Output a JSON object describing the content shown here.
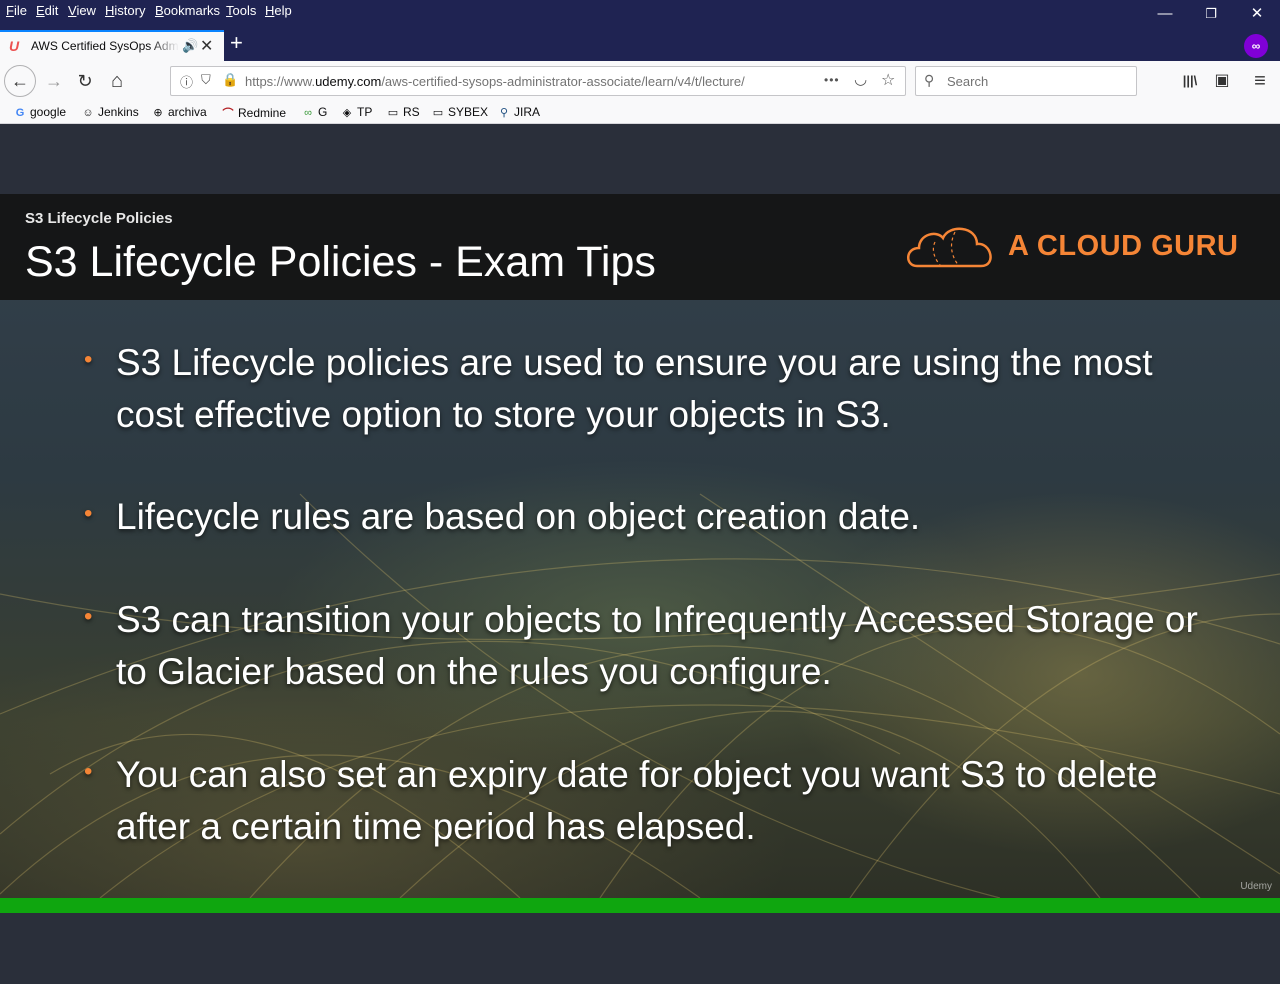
{
  "menubar": {
    "items": [
      "File",
      "Edit",
      "View",
      "History",
      "Bookmarks",
      "Tools",
      "Help"
    ],
    "window_controls": [
      "—",
      "❐",
      "✕"
    ]
  },
  "tab": {
    "title": "AWS Certified SysOps Administrator - Associate",
    "favicon": "U",
    "audio_icon": "🔊",
    "close": "✕",
    "new_tab": "+"
  },
  "private_badge": "∞",
  "navbar": {
    "back": "←",
    "forward": "→",
    "reload": "↻",
    "home": "⌂",
    "url_prefix": "https://www.",
    "url_domain": "udemy.com",
    "url_rest": "/aws-certified-sysops-administrator-associate/learn/v4/t/lecture/",
    "page_actions": "•••",
    "pocket": "◡",
    "bookmark_star": "☆",
    "search_placeholder": "Search",
    "library": "|||\\",
    "sidebar": "▣",
    "menu": "≡"
  },
  "bookmarks": [
    {
      "label": "google",
      "icon": "G"
    },
    {
      "label": "Jenkins",
      "icon": "☺"
    },
    {
      "label": "archiva",
      "icon": "⊕"
    },
    {
      "label": "Redmine",
      "icon": "⌒"
    },
    {
      "label": "G",
      "icon": "∞"
    },
    {
      "label": "TP",
      "icon": "◈"
    },
    {
      "label": "RS",
      "icon": "▭"
    },
    {
      "label": "SYBEX",
      "icon": "▭"
    },
    {
      "label": "JIRA",
      "icon": "⚲"
    }
  ],
  "slide": {
    "breadcrumb": "S3 Lifecycle Policies",
    "title": "S3 Lifecycle Policies - Exam Tips",
    "logo_text": "A CLOUD GURU",
    "bullet_marker": "•",
    "bullets": [
      "S3 Lifecycle policies are used to ensure you are using the most cost effective option to store your objects in S3.",
      "Lifecycle rules are based on object creation date.",
      "S3 can transition your objects to Infrequently Accessed Storage or to Glacier based on the rules you configure.",
      "You can also set an expiry date for object you want S3 to delete after a certain time period has elapsed."
    ],
    "watermark": "Udemy"
  },
  "colors": {
    "chrome_dark": "#1f2352",
    "accent_orange": "#f58536",
    "progress_green": "#0fa60f",
    "tab_indicator": "#0a84ff"
  }
}
